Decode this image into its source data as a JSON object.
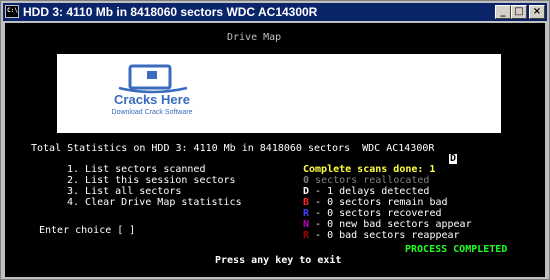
{
  "window": {
    "title": "HDD 3: 4110 Mb in 8418060 sectors  WDC AC14300R",
    "buttons": {
      "minimize": "_",
      "maximize": "□",
      "close": "×"
    }
  },
  "console": {
    "drive_map_title": "Drive Map",
    "drive_map_logo": {
      "brand": "Cracks Here",
      "tagline": "Download Crack Software"
    },
    "cursor_char": "D",
    "statistics_line": "Total Statistics on HDD 3: 4110 Mb in 8418060 sectors  WDC AC14300R",
    "menu": [
      "1. List sectors scanned",
      "2. List this session sectors",
      "3. List all sectors",
      "4. Clear Drive Map statistics"
    ],
    "complete_scans": "Complete scans done: 1",
    "stats": [
      {
        "key": "0",
        "text": " sectors reallocated",
        "color": "#808080",
        "text_color": "#808080"
      },
      {
        "key": "D",
        "text": " - 1 delays detected",
        "color": "#ffffff",
        "text_color": "#ffffff"
      },
      {
        "key": "B",
        "text": " - 0 sectors remain bad",
        "color": "#ff2020",
        "text_color": "#ffffff"
      },
      {
        "key": "R",
        "text": " - 0 sectors recovered",
        "color": "#4040ff",
        "text_color": "#ffffff"
      },
      {
        "key": "N",
        "text": " - 0 new bad sectors appear",
        "color": "#c000c0",
        "text_color": "#ffffff"
      },
      {
        "key": "R",
        "text": " - 0 bad sectors reappear",
        "color": "#a00000",
        "text_color": "#ffffff"
      }
    ],
    "enter_choice": "Enter choice [ ]",
    "process_status": "PROCESS COMPLETED",
    "press_key": "Press any key to exit"
  },
  "colors": {
    "title_bar": "#0a246a",
    "console_bg": "#000000",
    "yellow": "#ffff40",
    "green": "#20ff20"
  }
}
